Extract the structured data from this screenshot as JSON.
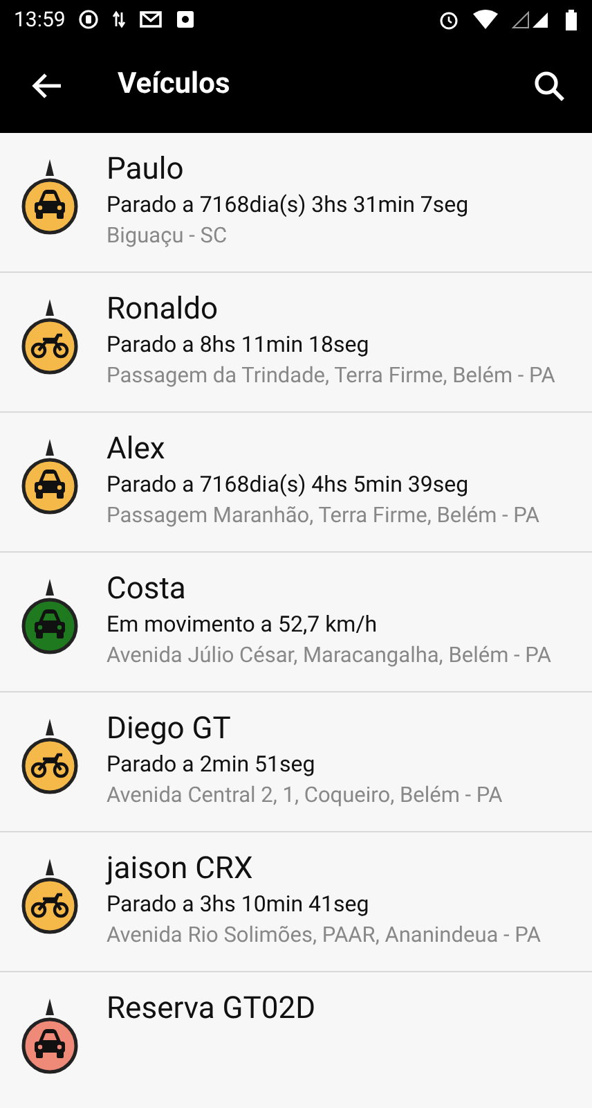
{
  "status_bar": {
    "time": "13:59"
  },
  "toolbar": {
    "title": "Veículos"
  },
  "vehicles": [
    {
      "name": "Paulo",
      "status": "Parado a 7168dia(s) 3hs 31min 7seg",
      "address": "Biguaçu - SC",
      "kind": "car",
      "color": "#f5b94a"
    },
    {
      "name": "Ronaldo",
      "status": "Parado a 8hs 11min 18seg",
      "address": "Passagem da Trindade, Terra Firme, Belém - PA",
      "kind": "motorcycle",
      "color": "#f5b94a"
    },
    {
      "name": "Alex",
      "status": "Parado a 7168dia(s) 4hs 5min 39seg",
      "address": "Passagem Maranhão, Terra Firme, Belém - PA",
      "kind": "car",
      "color": "#f5b94a"
    },
    {
      "name": "Costa",
      "status": "Em movimento a 52,7 km/h",
      "address": "Avenida Júlio César, Maracangalha, Belém - PA",
      "kind": "car",
      "color": "#1f7a1f"
    },
    {
      "name": "Diego GT",
      "status": "Parado a 2min 51seg",
      "address": "Avenida Central 2, 1, Coqueiro, Belém - PA",
      "kind": "motorcycle",
      "color": "#f5b94a"
    },
    {
      "name": "jaison CRX",
      "status": "Parado a 3hs 10min 41seg",
      "address": "Avenida Rio Solimões, PAAR, Ananindeua - PA",
      "kind": "motorcycle",
      "color": "#f5b94a"
    },
    {
      "name": "Reserva GT02D",
      "kind": "car",
      "color": "#f08a78"
    }
  ]
}
